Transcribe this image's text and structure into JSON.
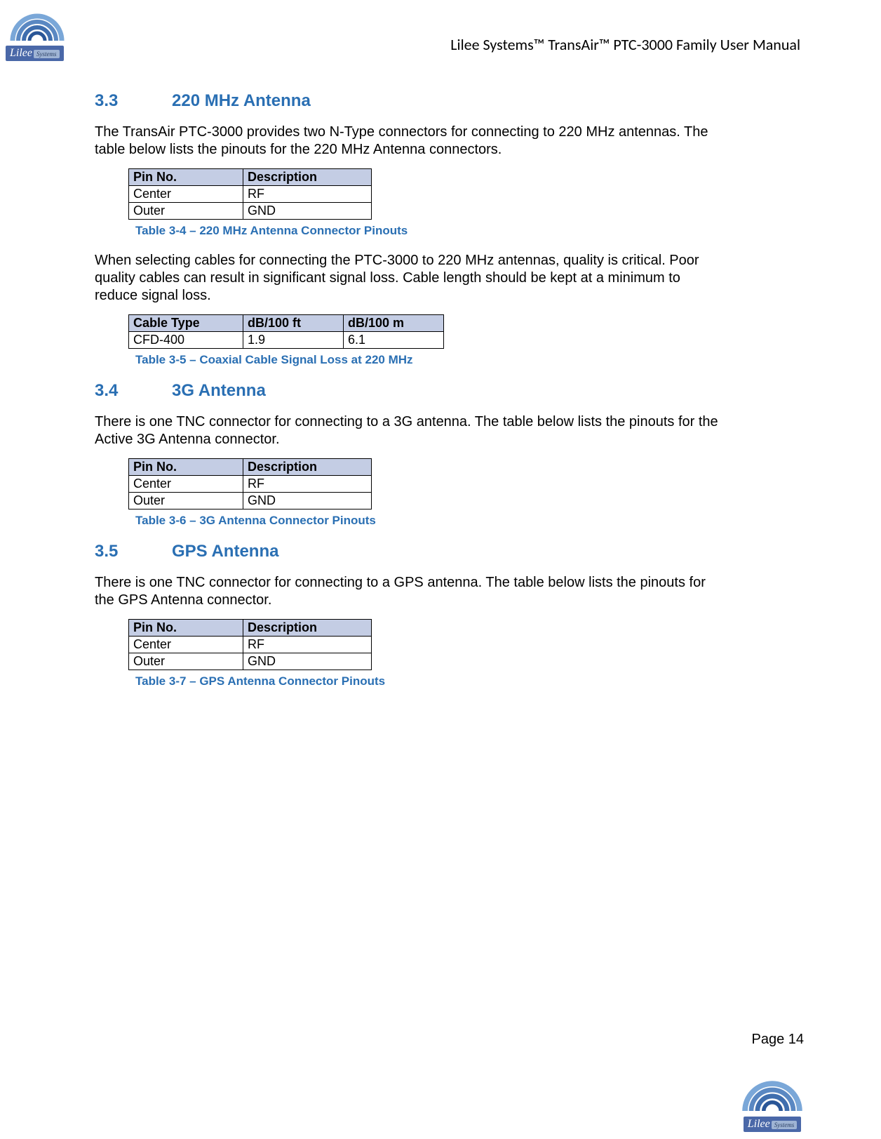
{
  "header": "Lilee Systems™ TransAir™ PTC-3000 Family User Manual",
  "brand": {
    "name": "Lilee",
    "tag": "Systems"
  },
  "sections": [
    {
      "num": "3.3",
      "title": "220 MHz Antenna",
      "para1": "The TransAir PTC-3000 provides two N-Type connectors for connecting to 220 MHz antennas. The table below lists the pinouts for the 220 MHz Antenna connectors.",
      "table1": {
        "headers": [
          "Pin No.",
          "Description"
        ],
        "rows": [
          [
            "Center",
            "RF"
          ],
          [
            "Outer",
            "GND"
          ]
        ],
        "caption": "Table 3-4  – 220 MHz Antenna Connector Pinouts"
      },
      "para2": "When selecting cables for connecting the PTC-3000 to 220 MHz antennas, quality is critical. Poor quality cables can result in significant signal loss. Cable length should be kept at a minimum to reduce signal loss.",
      "table2": {
        "headers": [
          "Cable Type",
          "dB/100 ft",
          "dB/100 m"
        ],
        "rows": [
          [
            "CFD-400",
            "1.9",
            "6.1"
          ]
        ],
        "caption": "Table 3-5  – Coaxial Cable Signal Loss at 220 MHz"
      }
    },
    {
      "num": "3.4",
      "title": "3G Antenna",
      "para1": "There is one TNC connector for connecting to a 3G antenna. The table below lists the pinouts for the Active 3G Antenna connector.",
      "table1": {
        "headers": [
          "Pin No.",
          "Description"
        ],
        "rows": [
          [
            "Center",
            "RF"
          ],
          [
            "Outer",
            "GND"
          ]
        ],
        "caption": "Table 3-6  – 3G Antenna Connector Pinouts"
      }
    },
    {
      "num": "3.5",
      "title": "GPS Antenna",
      "para1": "There is one TNC connector for connecting to a GPS antenna. The table below lists the pinouts for the GPS Antenna connector.",
      "table1": {
        "headers": [
          "Pin No.",
          "Description"
        ],
        "rows": [
          [
            "Center",
            "RF"
          ],
          [
            "Outer",
            "GND"
          ]
        ],
        "caption": "Table 3-7  – GPS Antenna Connector Pinouts"
      }
    }
  ],
  "pageNumber": "Page 14"
}
